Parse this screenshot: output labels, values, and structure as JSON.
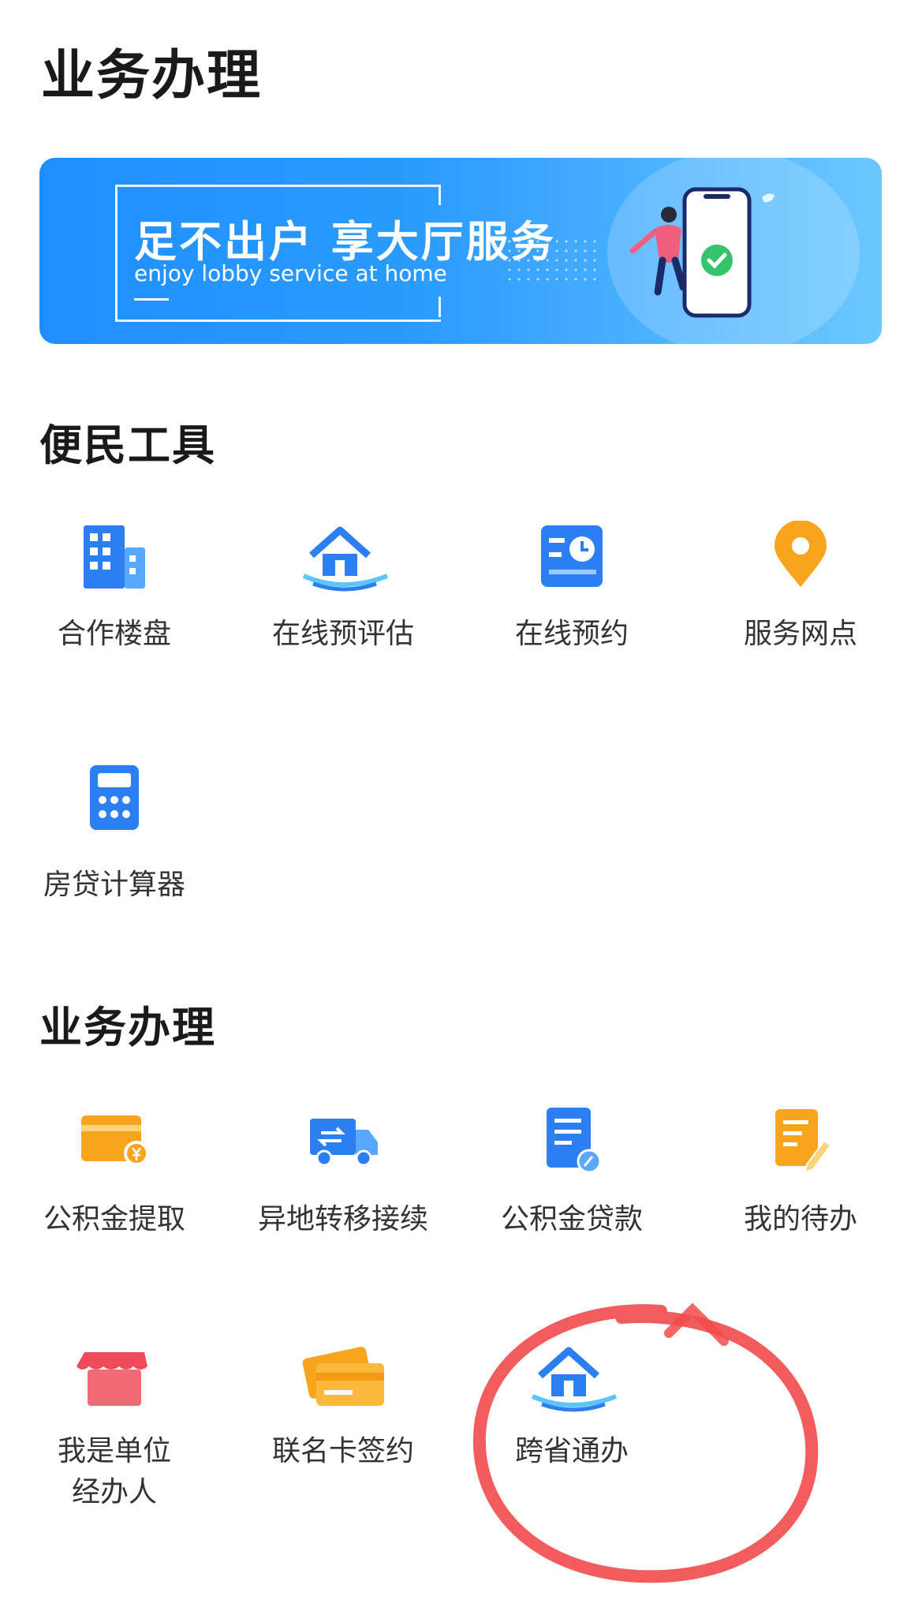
{
  "page": {
    "title": "业务办理"
  },
  "banner": {
    "slogan_cn": "足不出户 享大厅服务",
    "slogan_en": "enjoy lobby service at home"
  },
  "tools": {
    "title": "便民工具",
    "items": [
      {
        "label": "合作楼盘",
        "icon": "building-icon"
      },
      {
        "label": "在线预评估",
        "icon": "house-icon"
      },
      {
        "label": "在线预约",
        "icon": "clock-schedule-icon"
      },
      {
        "label": "服务网点",
        "icon": "location-pin-icon"
      },
      {
        "label": "房贷计算器",
        "icon": "calculator-icon"
      }
    ]
  },
  "business": {
    "title": "业务办理",
    "items": [
      {
        "label": "公积金提取",
        "icon": "wallet-yuan-icon"
      },
      {
        "label": "异地转移接续",
        "icon": "truck-icon"
      },
      {
        "label": "公积金贷款",
        "icon": "document-edit-icon"
      },
      {
        "label": "我的待办",
        "icon": "todo-pen-icon"
      },
      {
        "label": "我是单位\n经办人",
        "icon": "shop-icon"
      },
      {
        "label": "联名卡签约",
        "icon": "card-icon"
      },
      {
        "label": "跨省通办",
        "icon": "house-icon"
      }
    ]
  },
  "colors": {
    "accent": "#2b8cf5",
    "orange": "#f7a51c",
    "red": "#ef4c5a",
    "annotation": "#f24a4a"
  }
}
